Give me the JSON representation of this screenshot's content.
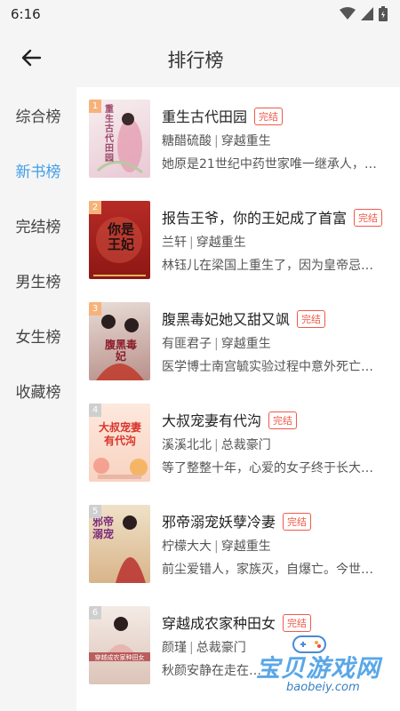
{
  "status_bar": {
    "time": "6:16"
  },
  "header": {
    "title": "排行榜"
  },
  "sidebar": {
    "items": [
      {
        "label": "综合榜"
      },
      {
        "label": "新书榜"
      },
      {
        "label": "完结榜"
      },
      {
        "label": "男生榜"
      },
      {
        "label": "女生榜"
      },
      {
        "label": "收藏榜"
      }
    ],
    "active_index": 1
  },
  "books": [
    {
      "rank": "1",
      "title": "重生古代田园",
      "badge": "完结",
      "author": "糖醋硫酸",
      "category": "穿越重生",
      "desc": "她原是21世纪中药世家唯一继承人，…",
      "cover_text": "重生古代田园",
      "cover_color": "#f3e6ea"
    },
    {
      "rank": "2",
      "title": "报告王爷，你的王妃成了首富",
      "badge": "完结",
      "author": "兰轩",
      "category": "穿越重生",
      "desc": "林钰儿在梁国上重生了，因为皇帝忌…",
      "cover_text": "你是王妃",
      "cover_color": "#a8201f"
    },
    {
      "rank": "3",
      "title": "腹黑毒妃她又甜又飒",
      "badge": "完结",
      "author": "有匪君子",
      "category": "穿越重生",
      "desc": "医学博士南宫毓实验过程中意外死亡…",
      "cover_text": "腹黑毒妃",
      "cover_color": "#d9c9c4"
    },
    {
      "rank": "4",
      "title": "大叔宠妻有代沟",
      "badge": "完结",
      "author": "溪溪北北",
      "category": "总裁豪门",
      "desc": "等了整整十年，心爱的女子终于长大…",
      "cover_text": "大叔宠妻有代沟",
      "cover_color": "#fbe9dc"
    },
    {
      "rank": "5",
      "title": "邪帝溺宠妖孽冷妻",
      "badge": "完结",
      "author": "柠檬大大",
      "category": "穿越重生",
      "desc": "前尘爱错人，家族灭，自爆亡。今世…",
      "cover_text": "邪帝溺宠",
      "cover_color": "#e8d2b5"
    },
    {
      "rank": "6",
      "title": "穿越成农家种田女",
      "badge": "完结",
      "author": "颜瑾",
      "category": "总裁豪门",
      "desc": "秋颜安静在走在…",
      "cover_text": "穿越成农家种田女",
      "cover_color": "#ecdcd2"
    }
  ],
  "watermark": {
    "text": "宝贝游戏网",
    "url": "baobeiy.com"
  },
  "colors": {
    "accent": "#3f9ee8",
    "badge": "#ef5a4a",
    "rank_bg": "#f7b27a"
  }
}
